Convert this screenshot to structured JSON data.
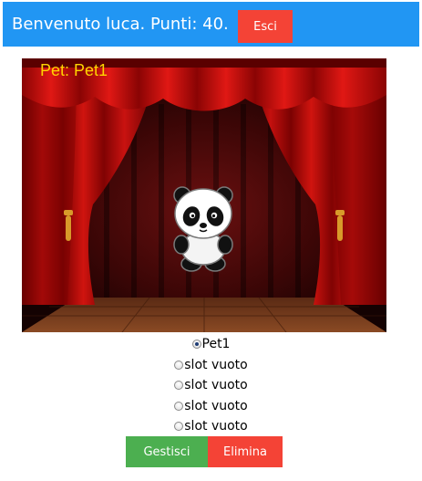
{
  "header": {
    "welcome_text": "Benvenuto luca. Punti: 40.",
    "logout_label": "Esci",
    "background_color": "#2196f3"
  },
  "stage": {
    "pet_label": "Pet: Pet1",
    "pet_icon": "panda-icon",
    "background": "theater-stage-red-curtains"
  },
  "slots": [
    {
      "label": "Pet1",
      "checked": true
    },
    {
      "label": "slot vuoto",
      "checked": false
    },
    {
      "label": "slot vuoto",
      "checked": false
    },
    {
      "label": "slot vuoto",
      "checked": false
    },
    {
      "label": "slot vuoto",
      "checked": false
    }
  ],
  "actions": {
    "manage_label": "Gestisci",
    "delete_label": "Elimina",
    "manage_color": "#4caf50",
    "delete_color": "#f44336"
  }
}
